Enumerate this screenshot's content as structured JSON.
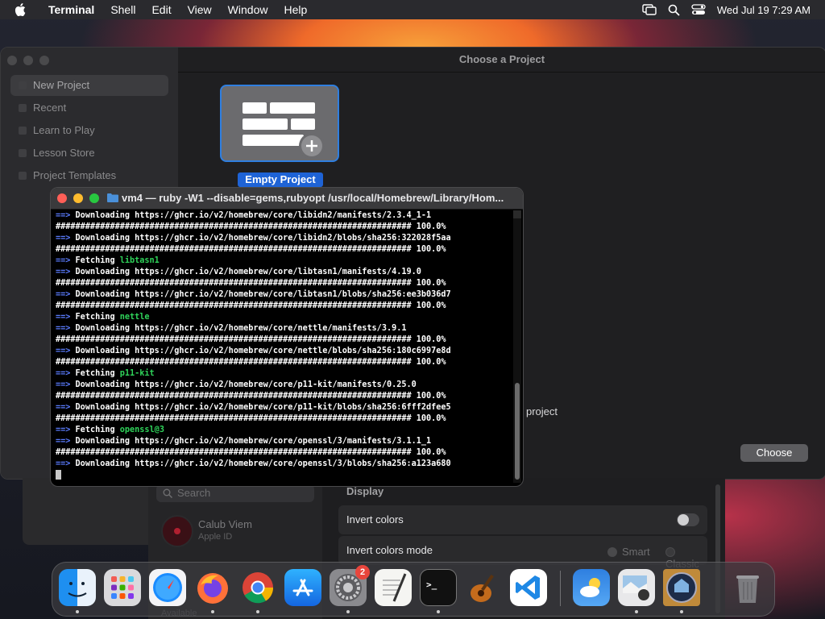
{
  "menubar": {
    "app_name": "Terminal",
    "items": [
      "Shell",
      "Edit",
      "View",
      "Window",
      "Help"
    ],
    "datetime": "Wed Jul 19  7:29 AM"
  },
  "chooser": {
    "title": "Choose a Project",
    "sidebar": [
      "New Project",
      "Recent",
      "Learn to Play",
      "Lesson Store",
      "Project Templates"
    ],
    "tile_label": "Empty Project",
    "project_text": "project",
    "choose_label": "Choose"
  },
  "terminal": {
    "title": "vm4 — ruby -W1 --disable=gems,rubyopt /usr/local/Homebrew/Library/Hom...",
    "lines": [
      {
        "kind": "dl",
        "text": "Downloading https://ghcr.io/v2/homebrew/core/libidn2/manifests/2.3.4_1-1"
      },
      {
        "kind": "bar",
        "text": "######################################################################## 100.0%"
      },
      {
        "kind": "dl",
        "text": "Downloading https://ghcr.io/v2/homebrew/core/libidn2/blobs/sha256:322028f5aa"
      },
      {
        "kind": "bar",
        "text": "######################################################################## 100.0%"
      },
      {
        "kind": "fetch",
        "text": "Fetching ",
        "pkg": "libtasn1"
      },
      {
        "kind": "dl",
        "text": "Downloading https://ghcr.io/v2/homebrew/core/libtasn1/manifests/4.19.0"
      },
      {
        "kind": "bar",
        "text": "######################################################################## 100.0%"
      },
      {
        "kind": "dl",
        "text": "Downloading https://ghcr.io/v2/homebrew/core/libtasn1/blobs/sha256:ee3b036d7"
      },
      {
        "kind": "bar",
        "text": "######################################################################## 100.0%"
      },
      {
        "kind": "fetch",
        "text": "Fetching ",
        "pkg": "nettle"
      },
      {
        "kind": "dl",
        "text": "Downloading https://ghcr.io/v2/homebrew/core/nettle/manifests/3.9.1"
      },
      {
        "kind": "bar",
        "text": "######################################################################## 100.0%"
      },
      {
        "kind": "dl",
        "text": "Downloading https://ghcr.io/v2/homebrew/core/nettle/blobs/sha256:180c6997e8d"
      },
      {
        "kind": "bar",
        "text": "######################################################################## 100.0%"
      },
      {
        "kind": "fetch",
        "text": "Fetching ",
        "pkg": "p11-kit"
      },
      {
        "kind": "dl",
        "text": "Downloading https://ghcr.io/v2/homebrew/core/p11-kit/manifests/0.25.0"
      },
      {
        "kind": "bar",
        "text": "######################################################################## 100.0%"
      },
      {
        "kind": "dl",
        "text": "Downloading https://ghcr.io/v2/homebrew/core/p11-kit/blobs/sha256:6fff2dfee5"
      },
      {
        "kind": "bar",
        "text": "######################################################################## 100.0%"
      },
      {
        "kind": "fetch",
        "text": "Fetching ",
        "pkg": "openssl@3"
      },
      {
        "kind": "dl",
        "text": "Downloading https://ghcr.io/v2/homebrew/core/openssl/3/manifests/3.1.1_1"
      },
      {
        "kind": "bar",
        "text": "######################################################################## 100.0%"
      },
      {
        "kind": "dl",
        "text": "Downloading https://ghcr.io/v2/homebrew/core/openssl/3/blobs/sha256:a123a680"
      }
    ],
    "arrow": "==>"
  },
  "settings": {
    "search_placeholder": "Search",
    "account_name": "Calub Viem",
    "account_sub": "Apple ID",
    "section": "Display",
    "row1_label": "Invert colors",
    "row2_label": "Invert colors mode",
    "radio_smart": "Smart",
    "radio_classic": "Classic",
    "bottom_text": "Available"
  },
  "dock": {
    "apps": [
      "finder",
      "launchpad",
      "safari",
      "firefox",
      "chrome",
      "app-store",
      "system-settings",
      "textedit",
      "terminal",
      "garageband",
      "vscode",
      "weather",
      "preview",
      "network-utility",
      "trash"
    ],
    "settings_badge": "2"
  }
}
